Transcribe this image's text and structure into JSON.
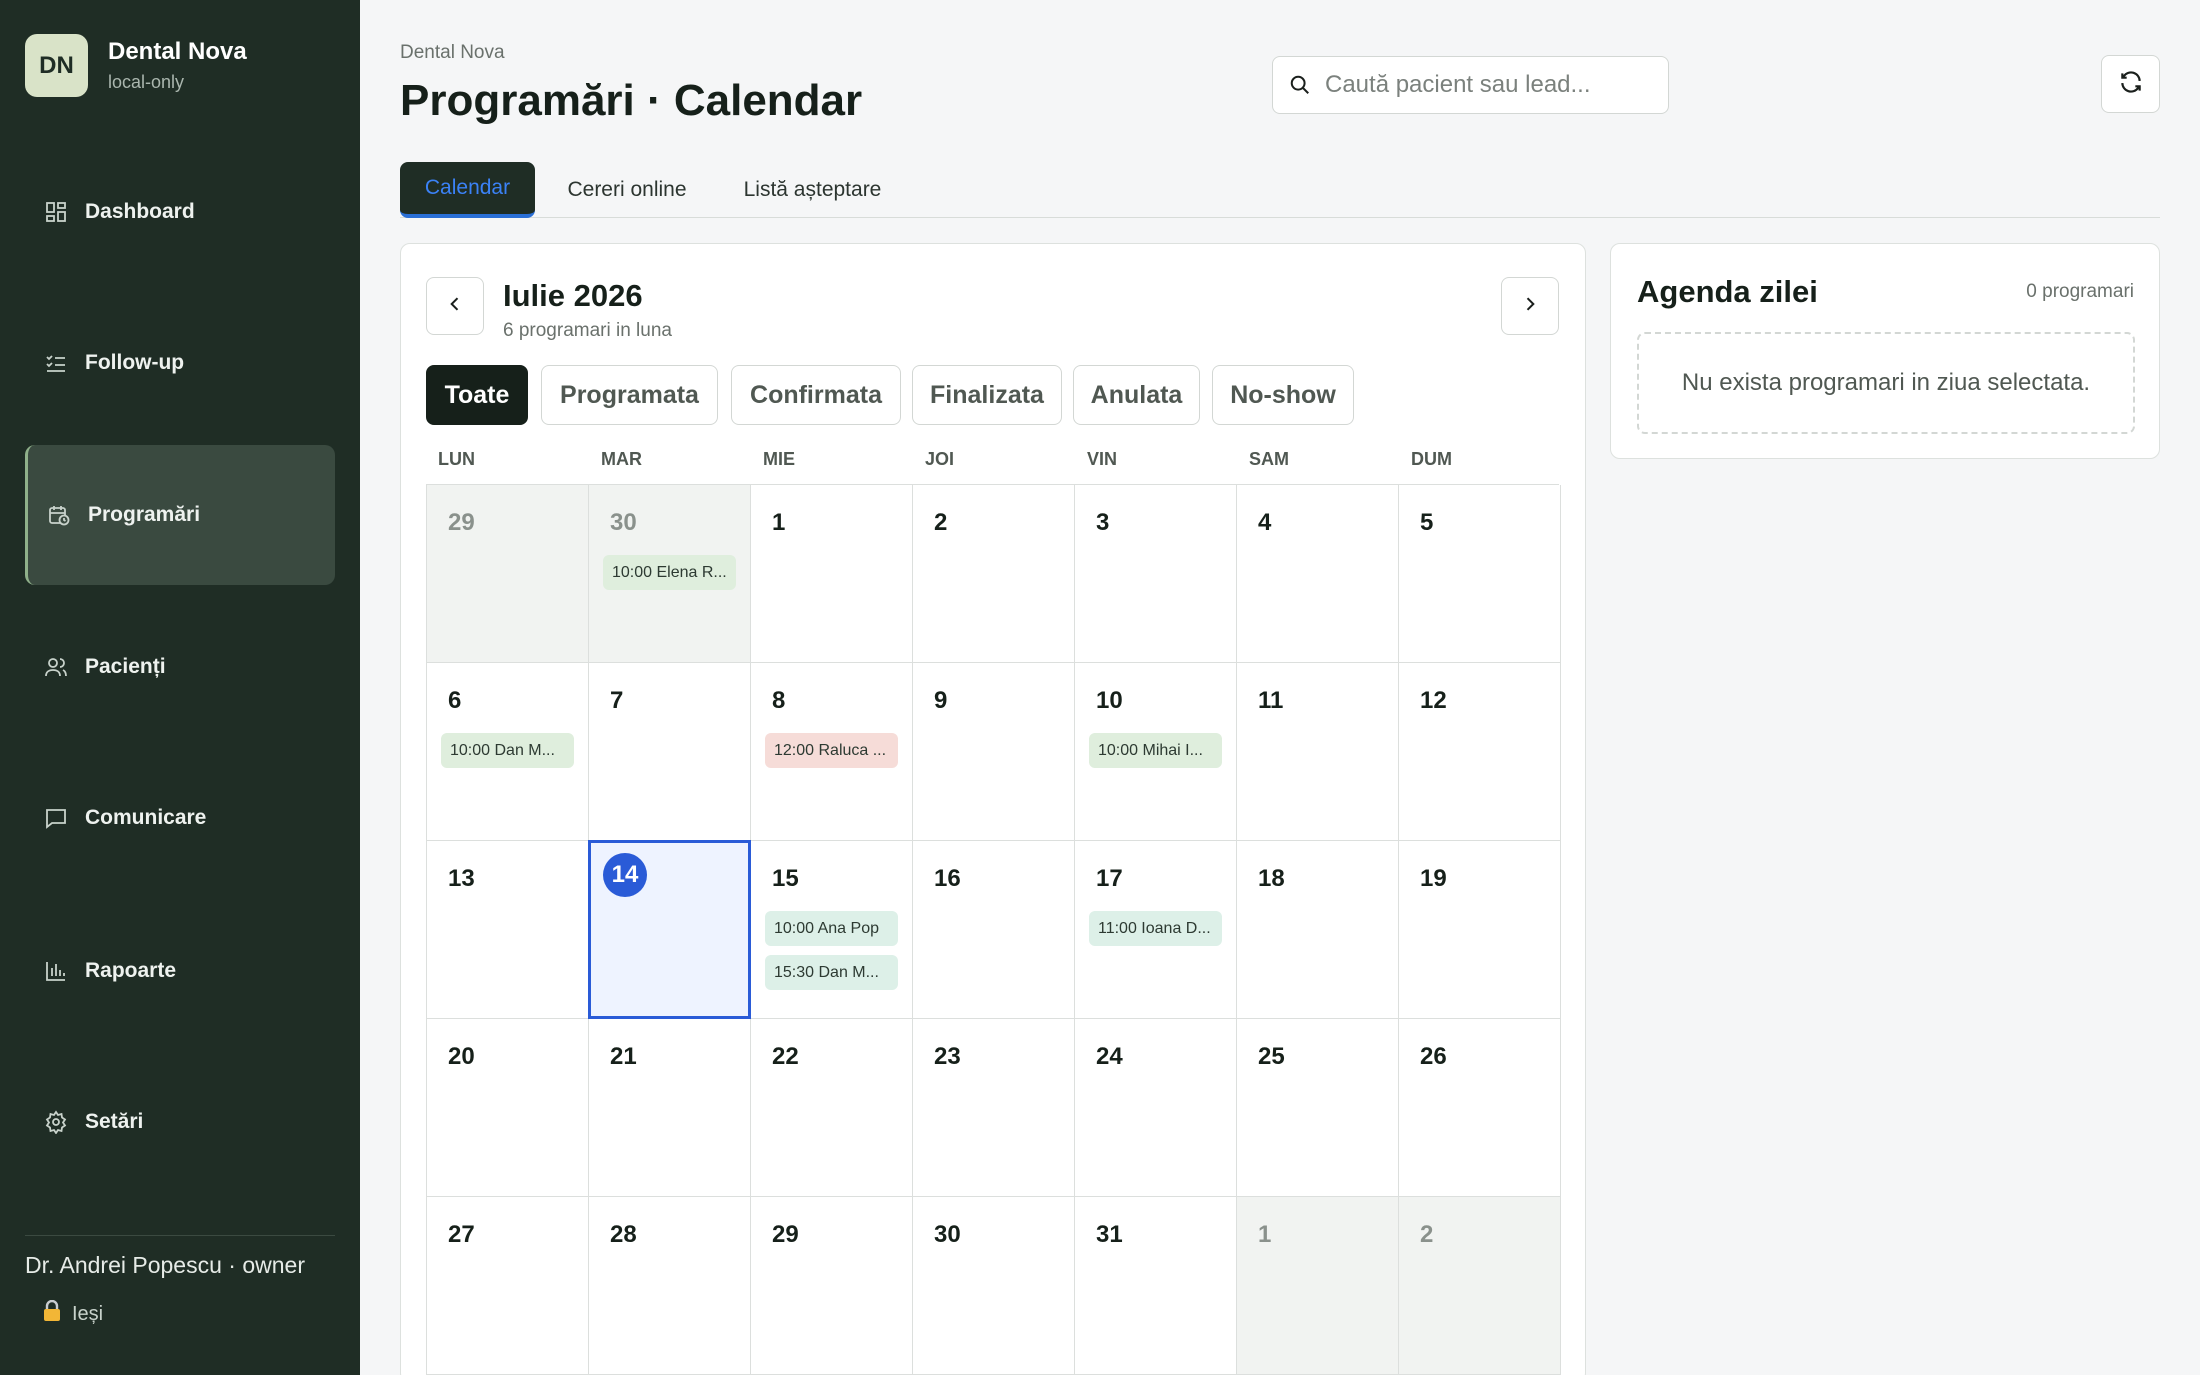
{
  "brand": {
    "initials": "DN",
    "name": "Dental Nova",
    "sub": "local-only"
  },
  "sidebar": {
    "items": [
      {
        "label": "Dashboard",
        "icon": "dashboard-icon"
      },
      {
        "label": "Follow-up",
        "icon": "checklist-icon"
      },
      {
        "label": "Programări",
        "icon": "calendar-clock-icon",
        "active": true
      },
      {
        "label": "Pacienți",
        "icon": "users-icon"
      },
      {
        "label": "Comunicare",
        "icon": "message-icon"
      },
      {
        "label": "Rapoarte",
        "icon": "bar-chart-icon"
      },
      {
        "label": "Setări",
        "icon": "gear-icon"
      }
    ],
    "user": "Dr. Andrei Popescu · owner",
    "logout": "Ieși"
  },
  "header": {
    "breadcrumb": "Dental Nova",
    "title": "Programări · Calendar",
    "search_placeholder": "Caută pacient sau lead..."
  },
  "tabs": [
    "Calendar",
    "Cereri online",
    "Listă așteptare"
  ],
  "calendar": {
    "month": "Iulie 2026",
    "summary": "6 programari in luna",
    "filters": [
      "Toate",
      "Programata",
      "Confirmata",
      "Finalizata",
      "Anulata",
      "No-show"
    ],
    "weekdays": [
      "LUN",
      "MAR",
      "MIE",
      "JOI",
      "VIN",
      "SAM",
      "DUM"
    ],
    "weeks": [
      [
        {
          "day": "29",
          "out": true
        },
        {
          "day": "30",
          "out": true,
          "events": [
            {
              "text": "10:00 Elena R...",
              "status": "green"
            }
          ]
        },
        {
          "day": "1"
        },
        {
          "day": "2"
        },
        {
          "day": "3"
        },
        {
          "day": "4"
        },
        {
          "day": "5"
        }
      ],
      [
        {
          "day": "6",
          "events": [
            {
              "text": "10:00 Dan M...",
              "status": "green"
            }
          ]
        },
        {
          "day": "7"
        },
        {
          "day": "8",
          "events": [
            {
              "text": "12:00 Raluca ...",
              "status": "red"
            }
          ]
        },
        {
          "day": "9"
        },
        {
          "day": "10",
          "events": [
            {
              "text": "10:00 Mihai I...",
              "status": "green"
            }
          ]
        },
        {
          "day": "11"
        },
        {
          "day": "12"
        }
      ],
      [
        {
          "day": "13"
        },
        {
          "day": "14",
          "today": true
        },
        {
          "day": "15",
          "events": [
            {
              "text": "10:00 Ana Pop",
              "status": "mint"
            },
            {
              "text": "15:30 Dan M...",
              "status": "mint"
            }
          ]
        },
        {
          "day": "16"
        },
        {
          "day": "17",
          "events": [
            {
              "text": "11:00 Ioana D...",
              "status": "mint"
            }
          ]
        },
        {
          "day": "18"
        },
        {
          "day": "19"
        }
      ],
      [
        {
          "day": "20"
        },
        {
          "day": "21"
        },
        {
          "day": "22"
        },
        {
          "day": "23"
        },
        {
          "day": "24"
        },
        {
          "day": "25"
        },
        {
          "day": "26"
        }
      ],
      [
        {
          "day": "27"
        },
        {
          "day": "28"
        },
        {
          "day": "29"
        },
        {
          "day": "30"
        },
        {
          "day": "31"
        },
        {
          "day": "1",
          "out": true
        },
        {
          "day": "2",
          "out": true
        }
      ]
    ]
  },
  "agenda": {
    "title": "Agenda zilei",
    "count": "0 programari",
    "empty": "Nu exista programari in ziua selectata."
  }
}
